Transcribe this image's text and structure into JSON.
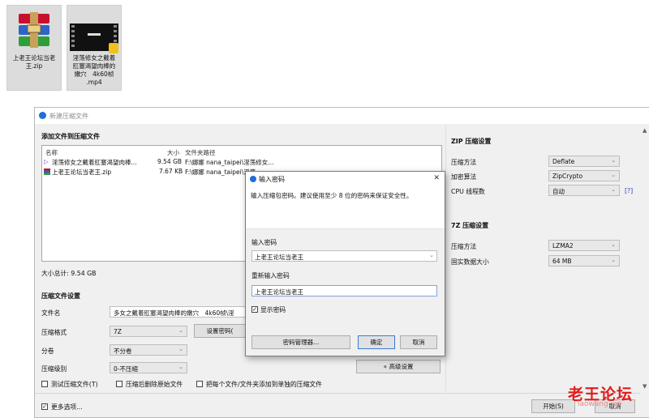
{
  "desktop": {
    "zip_icon_label": "上老王论坛当老王.zip",
    "mp4_icon_label_line1": "淫荡修女之戴着",
    "mp4_icon_label_line2": "肛塞渴望肉棒的",
    "mp4_icon_label_line3": "嫩穴　4k60帧",
    "mp4_icon_label_line4": ".mp4"
  },
  "window": {
    "title": "新建压缩文件",
    "add_section": "添加文件到压缩文件",
    "columns": {
      "name": "名称",
      "size": "大小",
      "path": "文件夹路径"
    },
    "files": [
      {
        "name": "淫荡修女之戴着肛塞渴望肉棒...",
        "size": "9.54 GB",
        "path": "F:\\娜娜 nana_taipei\\淫荡修女..."
      },
      {
        "name": "上老王论坛当老王.zip",
        "size": "7.67 KB",
        "path": "F:\\娜娜 nana_taipei\\淫荡"
      }
    ],
    "total_size": "大小总计: 9.54 GB",
    "settings_section": "压缩文件设置",
    "filename_label": "文件名",
    "filename_value": "多女之戴着肛塞渴望肉棒的嫩穴　4k60帧\\淫",
    "format_label": "压缩格式",
    "format_value": "7Z",
    "set_password_button": "设置密码(",
    "split_label": "分卷",
    "split_value": "不分卷",
    "level_label": "压缩级别",
    "level_value": "0-不压缩",
    "advanced_button": "« 高级设置",
    "opt_test": "测试压缩文件(T)",
    "opt_delete": "压缩后删除原始文件",
    "opt_separate": "把每个文件/文件夹添加到单独的压缩文件",
    "more_options": "更多选项...",
    "start_button": "开始(S)",
    "cancel_button": "取消"
  },
  "zip_settings": {
    "title": "ZIP 压缩设置",
    "method_label": "压缩方法",
    "method_value": "Deflate",
    "encrypt_label": "加密算法",
    "encrypt_value": "ZipCrypto",
    "cpu_label": "CPU 线程数",
    "cpu_value": "自动",
    "help": "[?]"
  },
  "sevenz_settings": {
    "title": "7Z 压缩设置",
    "method_label": "压缩方法",
    "method_value": "LZMA2",
    "solid_label": "固实数据大小",
    "solid_value": "64 MB"
  },
  "dialog": {
    "title": "输入密码",
    "close": "✕",
    "hint": "输入压缩包密码。建议使用至少 8 位的密码来保证安全性。",
    "password_label": "输入密码",
    "password_value": "上老王论坛当老王",
    "reenter_label": "重新输入密码",
    "reenter_value": "上老王论坛当老王",
    "show_password": "显示密码",
    "manager_button": "密码管理器...",
    "ok_button": "确定",
    "cancel_button": "取消"
  },
  "watermark": {
    "text": "老王论坛",
    "sub": "laowang.vip"
  },
  "colors": {
    "accent": "#1e6fd9",
    "watermark": "#e11b1b"
  }
}
